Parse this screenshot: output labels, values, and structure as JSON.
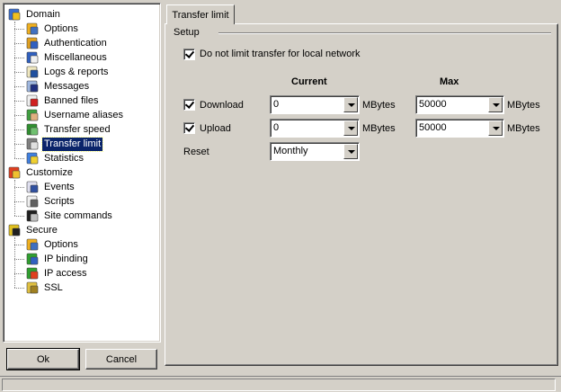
{
  "tree": [
    {
      "id": "domain",
      "label": "Domain",
      "level": 0,
      "icon": "domain-globe-icon",
      "selected": false
    },
    {
      "id": "options",
      "label": "Options",
      "level": 1,
      "icon": "options-icon",
      "selected": false
    },
    {
      "id": "authentication",
      "label": "Authentication",
      "level": 1,
      "icon": "authentication-icon",
      "selected": false
    },
    {
      "id": "miscellaneous",
      "label": "Miscellaneous",
      "level": 1,
      "icon": "miscellaneous-icon",
      "selected": false
    },
    {
      "id": "logs-reports",
      "label": "Logs & reports",
      "level": 1,
      "icon": "logs-icon",
      "selected": false
    },
    {
      "id": "messages",
      "label": "Messages",
      "level": 1,
      "icon": "messages-icon",
      "selected": false
    },
    {
      "id": "banned-files",
      "label": "Banned files",
      "level": 1,
      "icon": "banned-files-icon",
      "selected": false
    },
    {
      "id": "username-aliases",
      "label": "Username aliases",
      "level": 1,
      "icon": "user-icon",
      "selected": false
    },
    {
      "id": "transfer-speed",
      "label": "Transfer speed",
      "level": 1,
      "icon": "transfer-speed-icon",
      "selected": false
    },
    {
      "id": "transfer-limit",
      "label": "Transfer limit",
      "level": 1,
      "icon": "transfer-limit-icon",
      "selected": true
    },
    {
      "id": "statistics",
      "label": "Statistics",
      "level": 1,
      "icon": "statistics-icon",
      "selected": false
    },
    {
      "id": "customize",
      "label": "Customize",
      "level": 0,
      "icon": "customize-icon",
      "selected": false
    },
    {
      "id": "events",
      "label": "Events",
      "level": 1,
      "icon": "events-icon",
      "selected": false
    },
    {
      "id": "scripts",
      "label": "Scripts",
      "level": 1,
      "icon": "scripts-icon",
      "selected": false
    },
    {
      "id": "site-commands",
      "label": "Site commands",
      "level": 1,
      "icon": "console-icon",
      "selected": false
    },
    {
      "id": "secure",
      "label": "Secure",
      "level": 0,
      "icon": "secure-lock-icon",
      "selected": false
    },
    {
      "id": "secure-options",
      "label": "Options",
      "level": 1,
      "icon": "options-icon",
      "selected": false
    },
    {
      "id": "ip-binding",
      "label": "IP binding",
      "level": 1,
      "icon": "ip-binding-icon",
      "selected": false
    },
    {
      "id": "ip-access",
      "label": "IP access",
      "level": 1,
      "icon": "ip-access-icon",
      "selected": false
    },
    {
      "id": "ssl",
      "label": "SSL",
      "level": 1,
      "icon": "key-icon",
      "selected": false
    }
  ],
  "buttons": {
    "ok": "Ok",
    "cancel": "Cancel"
  },
  "tab": {
    "label": "Transfer limit"
  },
  "setup": {
    "group_label": "Setup",
    "no_limit_local_label": "Do not limit transfer for local network",
    "no_limit_local_checked": true,
    "current_header": "Current",
    "max_header": "Max",
    "download": {
      "label": "Download",
      "checked": true,
      "current": "0",
      "current_unit": "MBytes",
      "max": "50000",
      "max_unit": "MBytes"
    },
    "upload": {
      "label": "Upload",
      "checked": true,
      "current": "0",
      "current_unit": "MBytes",
      "max": "50000",
      "max_unit": "MBytes"
    },
    "reset": {
      "label": "Reset",
      "value": "Monthly"
    }
  }
}
